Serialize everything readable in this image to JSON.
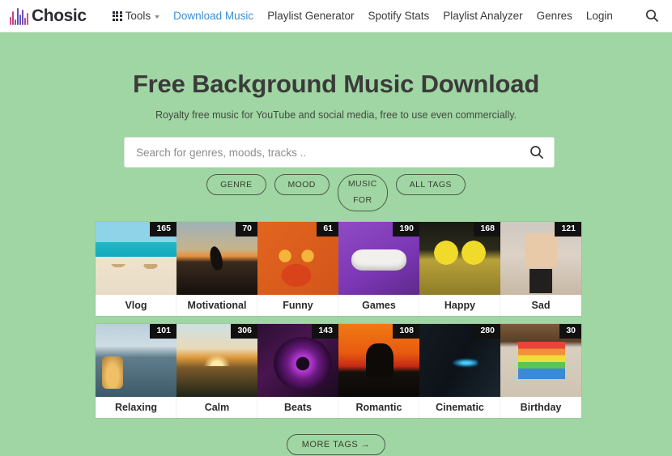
{
  "header": {
    "logo_text": "Chosic",
    "logo_icon": "sound-bars-icon",
    "nav": [
      {
        "label": "Tools",
        "icon": "grid-apps-icon",
        "has_caret": true,
        "active": false
      },
      {
        "label": "Download Music",
        "active": true
      },
      {
        "label": "Playlist Generator",
        "active": false
      },
      {
        "label": "Spotify Stats",
        "active": false
      },
      {
        "label": "Playlist Analyzer",
        "active": false
      },
      {
        "label": "Genres",
        "active": false
      },
      {
        "label": "Login",
        "active": false
      }
    ],
    "search_icon": "search-icon"
  },
  "hero": {
    "title": "Free Background Music Download",
    "subtitle": "Royalty free music for YouTube and social media, free to use even commercially."
  },
  "search": {
    "placeholder": "Search for genres, moods, tracks ..",
    "value": "",
    "button_icon": "search-icon"
  },
  "filters": [
    {
      "label": "GENRE",
      "size": "small"
    },
    {
      "label": "MOOD",
      "size": "small"
    },
    {
      "label": "MUSIC",
      "label2": "FOR",
      "size": "tall"
    },
    {
      "label": "ALL TAGS",
      "size": "small"
    }
  ],
  "tags": [
    {
      "name": "Vlog",
      "count": "165",
      "art": "t-vlog"
    },
    {
      "name": "Motivational",
      "count": "70",
      "art": "t-motivational"
    },
    {
      "name": "Funny",
      "count": "61",
      "art": "t-funny"
    },
    {
      "name": "Games",
      "count": "190",
      "art": "t-games"
    },
    {
      "name": "Happy",
      "count": "168",
      "art": "t-happy"
    },
    {
      "name": "Sad",
      "count": "121",
      "art": "t-sad"
    },
    {
      "name": "Relaxing",
      "count": "101",
      "art": "t-relaxing"
    },
    {
      "name": "Calm",
      "count": "306",
      "art": "t-calm"
    },
    {
      "name": "Beats",
      "count": "143",
      "art": "t-beats"
    },
    {
      "name": "Romantic",
      "count": "108",
      "art": "t-romantic"
    },
    {
      "name": "Cinematic",
      "count": "280",
      "art": "t-cinematic"
    },
    {
      "name": "Birthday",
      "count": "30",
      "art": "t-birthday"
    }
  ],
  "more_tags_label": "MORE TAGS →",
  "colors": {
    "page_background": "#a0d6a3",
    "header_background": "#ffffff",
    "active_nav": "#3a8fd4",
    "nav_text": "#3a3a3a",
    "title_text": "#3b3b3b",
    "badge_background": "#111111",
    "badge_text": "#ffffff",
    "pill_border": "#4d5b4d"
  }
}
